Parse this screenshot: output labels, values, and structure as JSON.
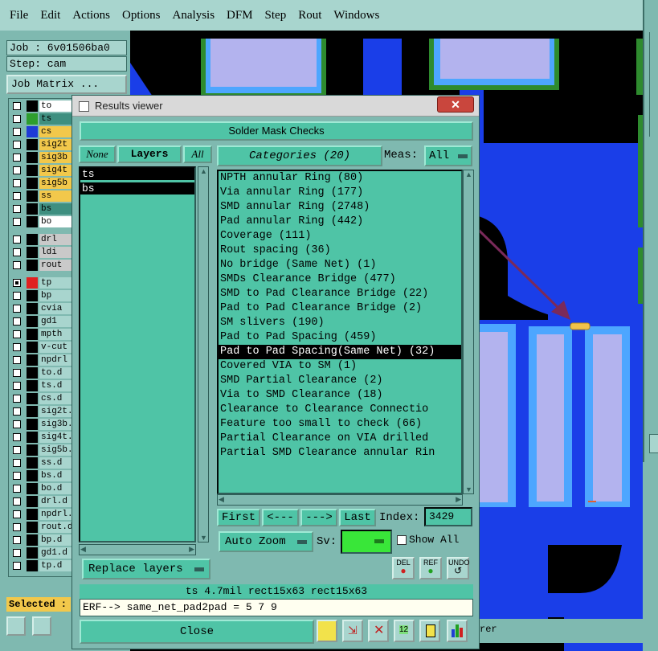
{
  "menubar": [
    "File",
    "Edit",
    "Actions",
    "Options",
    "Analysis",
    "DFM",
    "Step",
    "Rout",
    "Windows"
  ],
  "job": {
    "job": "Job : 6v01506ba0",
    "step": "Step: cam",
    "matrix_btn": "Job Matrix ..."
  },
  "layers": [
    {
      "name": "to",
      "color": "#ffffff",
      "sw": "#000000",
      "checked": false
    },
    {
      "name": "ts",
      "color": "#3e8f80",
      "sw": "#2e9e2e",
      "checked": false
    },
    {
      "name": "cs",
      "color": "#f2c84b",
      "sw": "#1f3bd6",
      "checked": false
    },
    {
      "name": "sig2t",
      "color": "#f2c84b",
      "sw": "#000000",
      "checked": false
    },
    {
      "name": "sig3b",
      "color": "#f2c84b",
      "sw": "#000000",
      "checked": false
    },
    {
      "name": "sig4t",
      "color": "#f2c84b",
      "sw": "#000000",
      "checked": false
    },
    {
      "name": "sig5b",
      "color": "#f2c84b",
      "sw": "#000000",
      "checked": false
    },
    {
      "name": "ss",
      "color": "#f2c84b",
      "sw": "#000000",
      "checked": false
    },
    {
      "name": "bs",
      "color": "#3e8f80",
      "sw": "#000000",
      "checked": false
    },
    {
      "name": "bo",
      "color": "#ffffff",
      "sw": "#000000",
      "checked": false
    },
    {
      "name": "drl",
      "color": "#c9c9c9",
      "sw": "#000000",
      "checked": false
    },
    {
      "name": "ldi",
      "color": "#c9c9c9",
      "sw": "#000000",
      "checked": false
    },
    {
      "name": "rout",
      "color": "#c9c9c9",
      "sw": "#000000",
      "checked": false
    },
    {
      "name": "tp",
      "color": "#a8d5ce",
      "sw": "#e02020",
      "checked": true
    },
    {
      "name": "bp",
      "color": "#a8d5ce",
      "sw": "#000000",
      "checked": false
    },
    {
      "name": "cvia",
      "color": "#a8d5ce",
      "sw": "#000000",
      "checked": false
    },
    {
      "name": "gd1",
      "color": "#a8d5ce",
      "sw": "#000000",
      "checked": false
    },
    {
      "name": "mpth",
      "color": "#a8d5ce",
      "sw": "#000000",
      "checked": false
    },
    {
      "name": "v-cut",
      "color": "#a8d5ce",
      "sw": "#000000",
      "checked": false
    },
    {
      "name": "npdrl",
      "color": "#a8d5ce",
      "sw": "#000000",
      "checked": false
    },
    {
      "name": "to.d",
      "color": "#a8d5ce",
      "sw": "#000000",
      "checked": false
    },
    {
      "name": "ts.d",
      "color": "#a8d5ce",
      "sw": "#000000",
      "checked": false
    },
    {
      "name": "cs.d",
      "color": "#a8d5ce",
      "sw": "#000000",
      "checked": false
    },
    {
      "name": "sig2t.",
      "color": "#a8d5ce",
      "sw": "#000000",
      "checked": false
    },
    {
      "name": "sig3b.",
      "color": "#a8d5ce",
      "sw": "#000000",
      "checked": false
    },
    {
      "name": "sig4t.",
      "color": "#a8d5ce",
      "sw": "#000000",
      "checked": false
    },
    {
      "name": "sig5b.",
      "color": "#a8d5ce",
      "sw": "#000000",
      "checked": false
    },
    {
      "name": "ss.d",
      "color": "#a8d5ce",
      "sw": "#000000",
      "checked": false
    },
    {
      "name": "bs.d",
      "color": "#a8d5ce",
      "sw": "#000000",
      "checked": false
    },
    {
      "name": "bo.d",
      "color": "#a8d5ce",
      "sw": "#000000",
      "checked": false
    },
    {
      "name": "drl.d",
      "color": "#a8d5ce",
      "sw": "#000000",
      "checked": false
    },
    {
      "name": "npdrl.",
      "color": "#a8d5ce",
      "sw": "#000000",
      "checked": false
    },
    {
      "name": "rout.d",
      "color": "#a8d5ce",
      "sw": "#000000",
      "checked": false
    },
    {
      "name": "bp.d",
      "color": "#a8d5ce",
      "sw": "#000000",
      "checked": false
    },
    {
      "name": "gd1.d",
      "color": "#a8d5ce",
      "sw": "#000000",
      "checked": false
    },
    {
      "name": "tp.d",
      "color": "#a8d5ce",
      "sw": "#000000",
      "checked": false
    }
  ],
  "selected_label": "Selected :",
  "results_viewer": {
    "title": "Results viewer",
    "heading": "Solder Mask Checks",
    "none_btn": "None",
    "layers_btn": "Layers",
    "all_btn": "All",
    "layer_items": [
      "ts",
      "bs"
    ],
    "categories_btn": "Categories (20)",
    "meas_label": "Meas:",
    "meas_value": "All",
    "categories": [
      "NPTH annular Ring (80)",
      "Via annular Ring (177)",
      "SMD annular Ring (2748)",
      "Pad annular Ring (442)",
      "Coverage (111)",
      "Rout spacing (36)",
      "No bridge (Same Net) (1)",
      "SMDs Clearance Bridge (477)",
      "SMD to Pad Clearance Bridge (22)",
      "Pad to Pad Clearance Bridge (2)",
      "SM slivers (190)",
      "Pad to Pad Spacing (459)",
      "Pad to Pad Spacing(Same Net) (32)",
      "Covered VIA to SM (1)",
      "SMD Partial Clearance (2)",
      "Via to SMD Clearance (18)",
      "Clearance to Clearance Connectio",
      "Feature too small to check (66)",
      "Partial Clearance on VIA drilled",
      "Partial SMD Clearance annular Rin"
    ],
    "selected_index": 12,
    "nav": {
      "first": "First",
      "prev": "<---",
      "next": "--->",
      "last": "Last",
      "index_label": "Index:",
      "index_value": "3429"
    },
    "auto_zoom": "Auto Zoom",
    "sv_label": "Sv:",
    "show_all": "Show All",
    "replace_layers": "Replace layers",
    "icons": {
      "del": "DEL",
      "ref": "REF",
      "undo": "UNDO"
    },
    "info_line": "ts 4.7mil   rect15x63   rect15x63",
    "erf_line": "ERF--> same_net_pad2pad = 5 7 9",
    "close_btn": "Close",
    "status_tail": "rer"
  },
  "colors": {
    "pcb_blue": "#1a3ee8",
    "pad_fill": "#b3b3ee",
    "pad_edge": "#4da6ff",
    "copper_green": "#2e8b2e",
    "arrow": "#7a2a5a",
    "marker": "#f2c24b"
  }
}
